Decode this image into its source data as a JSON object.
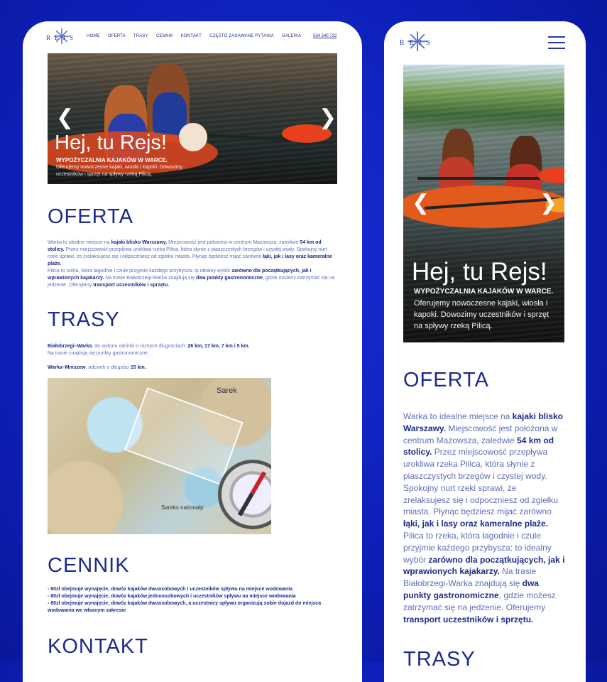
{
  "brand": {
    "logo_text": "REJS"
  },
  "nav": {
    "items": [
      "HOME",
      "OFERTA",
      "TRASY",
      "CENNIK",
      "KONTAKT",
      "CZĘSTO ZADAWANE PYTANIA",
      "GALERIA"
    ],
    "phone": "534 540 722"
  },
  "hero": {
    "title": "Hej, tu Rejs!",
    "subtitle": "WYPOŻYCZALNIA KAJAKÓW W WARCE.",
    "desc_desktop": "Oferujemy nowoczesne kajaki, wiosła i kapoki. Dowozimy uczestników i sprzęt na spływy rzeką Pilicą.",
    "desc_mobile": "Oferujemy nowoczesne kajaki, wiosła i kapoki. Dowozimy uczestników i sprzęt na spływy rzeką Pilicą."
  },
  "oferta": {
    "heading": "OFERTA",
    "p1a": "Warka to idealne miejsce na ",
    "p1b": "kajaki blisko Warszawy.",
    "p1c": " Miejscowość jest położona w centrum Mazowsza, zaledwie ",
    "p1d": "54 km od stolicy.",
    "p1e": " Przez miejscowość przepływa urokliwa rzeka Pilica, która słynie z piaszczystych brzegów i czystej wody. Spokojny nurt rzeki sprawi, że zrelaksujesz się i odpoczniesz od zgiełku miasta. Płynąc będziesz mijać zarówno ",
    "p1f": "łąki, jak i lasy oraz kameralne plaże.",
    "p2a": "Pilica to rzeka, która łagodnie i czule przyjmie każdego przybysza: to idealny wybór ",
    "p2b": "zarówno dla początkujących, jak i wprawionych kajakarzy.",
    "p2c": " Na trasie Białobrzegi-Warka znajdują się ",
    "p2d": "dwa punkty gastronomiczne",
    "p2e": ", gdzie możesz zatrzymać się na jedzenie. Oferujemy ",
    "p2f": "transport uczestników i sprzętu."
  },
  "trasy": {
    "heading": "TRASY",
    "r1a": "Białobrzegi–Warka",
    "r1b": ", do wyboru odcinki o różnych długościach: ",
    "r1c": "26 km, 17 km, 7 km i 5 km.",
    "r1d": "Na trasie znajdują się punkty gastronomiczne.",
    "r2a": "Warka–Mniszew",
    "r2b": ", odcinek o długości ",
    "r2c": "15 km."
  },
  "map": {
    "label1": "Sarek",
    "label2": "Sareks nationalp"
  },
  "cennik": {
    "heading": "CENNIK",
    "items": [
      "- 80zł obejmuje wynajęcie, dowóz kajaków dwuosobowych i uczestników spływu na miejsce wodowania",
      "- 60zł obejmuje wynajęcie, dowóz kajaków jednoosobowych i uczestników spływu na miejsce wodowania",
      "- 60zł obejmuje wynajęcie, dowóz kajaków dwuosobowych, a uczestnicy spływu organizują sobie dojazd do miejsca wodowania we własnym zakresie"
    ]
  },
  "kontakt": {
    "heading": "KONTAKT"
  },
  "mobile": {
    "trasy_heading": "TRASY"
  }
}
